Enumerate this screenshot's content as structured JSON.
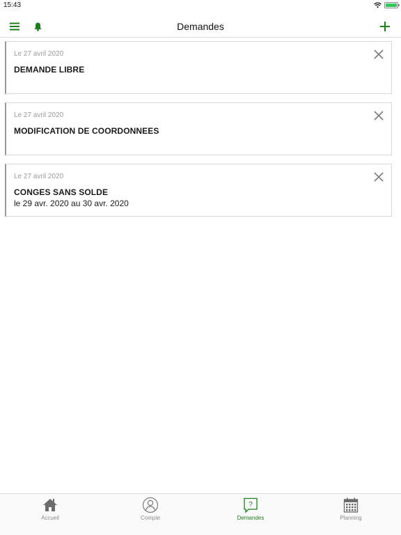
{
  "status_bar": {
    "time": "15:43",
    "battery_level": 1.0
  },
  "nav": {
    "title": "Demandes",
    "accent_color": "#1e7d1e"
  },
  "requests": [
    {
      "date": "Le 27 avril 2020",
      "title": "DEMANDE LIBRE",
      "subtitle": ""
    },
    {
      "date": "Le 27 avril 2020",
      "title": "MODIFICATION DE COORDONNEES",
      "subtitle": ""
    },
    {
      "date": "Le 27 avril 2020",
      "title": "CONGES SANS SOLDE",
      "subtitle": "le 29 avr. 2020 au 30 avr. 2020"
    }
  ],
  "tabs": [
    {
      "label": "Accueil",
      "icon": "home-icon",
      "active": false
    },
    {
      "label": "Compte",
      "icon": "user-icon",
      "active": false
    },
    {
      "label": "Demandes",
      "icon": "question-bubble-icon",
      "active": true
    },
    {
      "label": "Planning",
      "icon": "calendar-icon",
      "active": false
    }
  ]
}
